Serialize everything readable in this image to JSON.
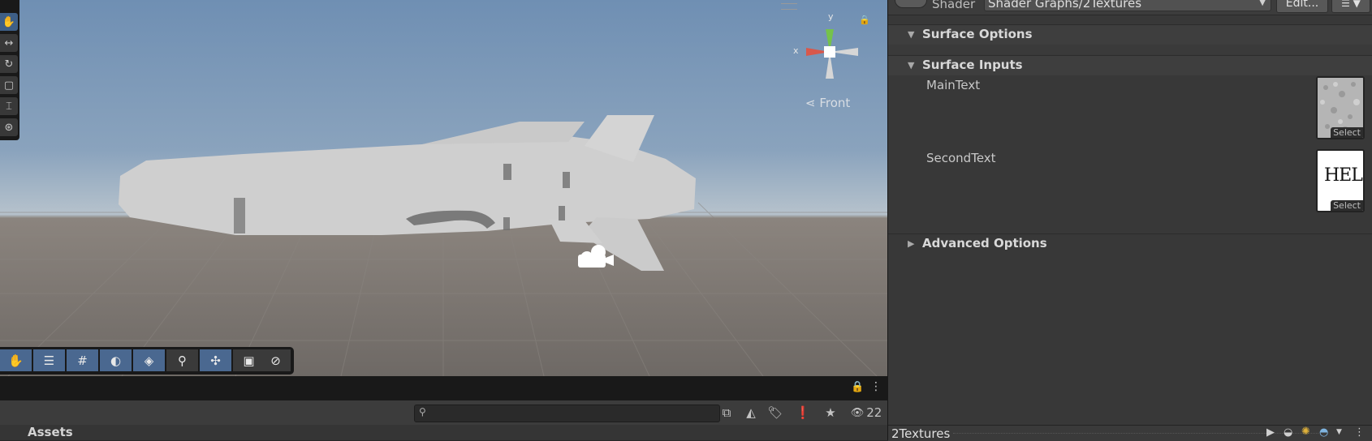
{
  "viewport": {
    "view_label": "Front",
    "axis_x": "x",
    "axis_y": "y",
    "toolbar_icons": [
      "hand-icon",
      "move-icon",
      "rotate-icon",
      "scale-icon",
      "rect-icon",
      "transform-icon"
    ],
    "overlay_icons": [
      "hand-icon",
      "sliders-icon",
      "grid-icon",
      "shading-icon",
      "layers-icon",
      "search-icon",
      "pivot-icon",
      "camera-icon",
      "compass-icon"
    ]
  },
  "project": {
    "visibility_count": "22",
    "assets_label": "Assets"
  },
  "inspector": {
    "shader_label": "Shader",
    "shader_value": "Shader Graphs/2Textures",
    "edit_label": "Edit...",
    "sections": {
      "surface_options": "Surface Options",
      "surface_inputs": "Surface Inputs",
      "advanced_options": "Advanced Options"
    },
    "properties": [
      {
        "label": "MainText",
        "select": "Select"
      },
      {
        "label": "SecondText",
        "select": "Select",
        "texture_text": "HELP"
      }
    ],
    "footer_name": "2Textures"
  },
  "colors": {
    "accent_blue": "#3e5f87",
    "panel": "#383838",
    "toolbar_dark": "#191919"
  }
}
